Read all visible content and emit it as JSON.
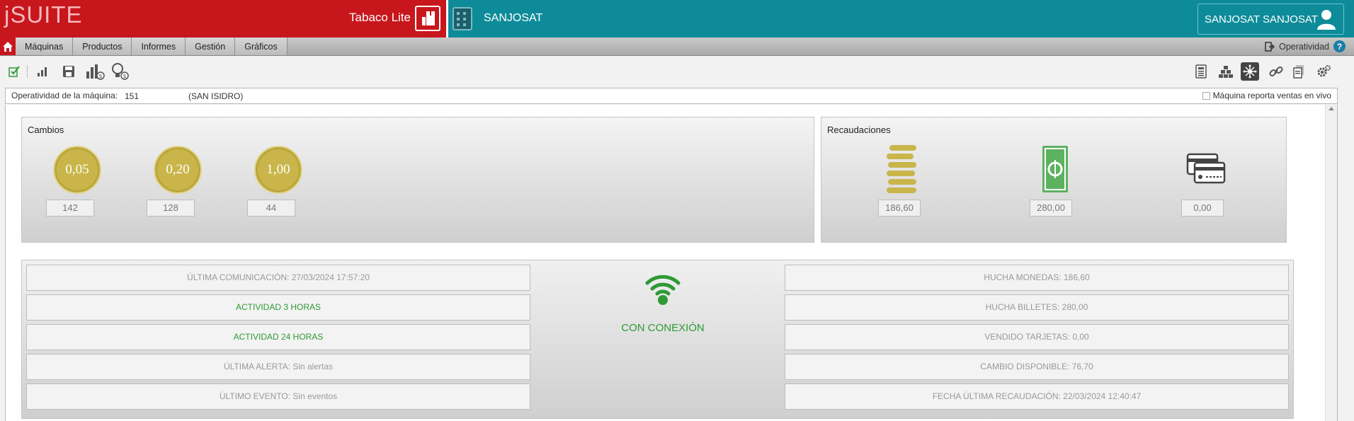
{
  "header": {
    "logo": "jSUITE",
    "product": "Tabaco Lite",
    "company": "SANJOSAT",
    "user": "SANJOSAT SANJOSAT"
  },
  "menu": {
    "items": [
      "Máquinas",
      "Productos",
      "Informes",
      "Gestión",
      "Gráficos"
    ],
    "right_label": "Operatividad",
    "help": "?"
  },
  "operatividad": {
    "label": "Operatividad de la máquina:",
    "machine_number": "151",
    "location": "(SAN ISIDRO)",
    "live_sales_label": "Máquina reporta ventas en vivo"
  },
  "cambios": {
    "title": "Cambios",
    "coins": [
      {
        "denomination": "0,05",
        "count": "142"
      },
      {
        "denomination": "0,20",
        "count": "128"
      },
      {
        "denomination": "1,00",
        "count": "44"
      }
    ]
  },
  "recaudaciones": {
    "title": "Recaudaciones",
    "items": [
      {
        "icon": "coin-stack-icon",
        "value": "186,60"
      },
      {
        "icon": "banknote-icon",
        "value": "280,00"
      },
      {
        "icon": "credit-cards-icon",
        "value": "0,00"
      }
    ]
  },
  "status": {
    "left": [
      {
        "text": "ÚLTIMA COMUNICACIÓN: 27/03/2024 17:57:20",
        "green": false
      },
      {
        "text": "ACTIVIDAD 3 HORAS",
        "green": true
      },
      {
        "text": "ACTIVIDAD 24 HORAS",
        "green": true
      },
      {
        "text": "ÚLTIMA ALERTA: Sin alertas",
        "green": false
      },
      {
        "text": "ÚLTIMO EVENTO: Sin eventos",
        "green": false
      }
    ],
    "connection": "CON CONEXIÓN",
    "right": [
      {
        "text": "HUCHA MONEDAS: 186,60"
      },
      {
        "text": "HUCHA BILLETES: 280,00"
      },
      {
        "text": "VENDIDO TARJETAS: 0,00"
      },
      {
        "text": "CAMBIO DISPONIBLE: 76,70"
      },
      {
        "text": "FECHA ÚLTIMA RECAUDACIÓN: 22/03/2024 12:40:47"
      }
    ]
  },
  "colors": {
    "brand_red": "#c8161d",
    "header_teal": "#0e8b99",
    "status_green": "#2e9a35",
    "coin_gold": "#c9b54a"
  }
}
